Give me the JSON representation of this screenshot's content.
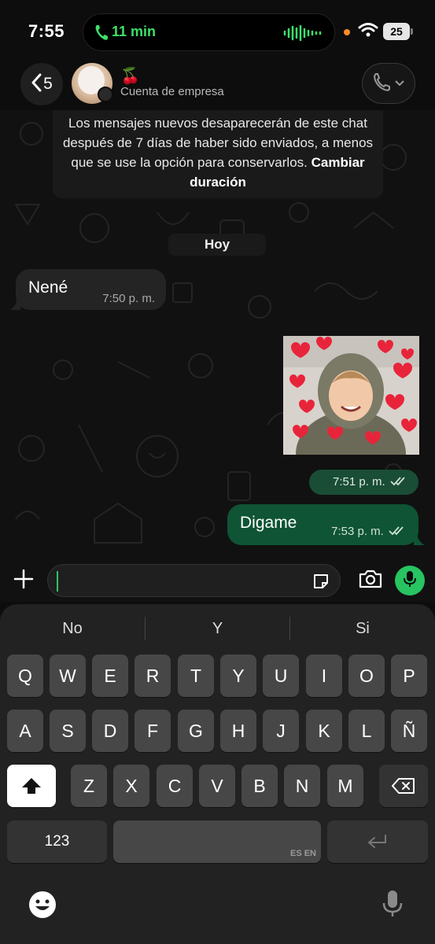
{
  "status_bar": {
    "time": "7:55",
    "call_duration": "11 min",
    "battery": "25"
  },
  "header": {
    "back_count": "5",
    "contact_emoji": "🍒",
    "subtitle": "Cuenta de empresa"
  },
  "notice": {
    "text": "Los mensajes nuevos desaparecerán de este chat después de 7 días de haber sido enviados, a menos que se use la opción para conservarlos.",
    "link": "Cambiar duración"
  },
  "day_label": "Hoy",
  "messages": [
    {
      "direction": "in",
      "text": "Nené",
      "time": "7:50 p. m."
    },
    {
      "direction": "out",
      "type": "image",
      "time": "7:51 p. m."
    },
    {
      "direction": "out",
      "text": "Digame",
      "time": "7:53 p. m."
    }
  ],
  "composer": {
    "value": "",
    "placeholder": ""
  },
  "keyboard": {
    "suggestions": [
      "No",
      "Y",
      "Si"
    ],
    "row1": [
      "Q",
      "W",
      "E",
      "R",
      "T",
      "Y",
      "U",
      "I",
      "O",
      "P"
    ],
    "row2": [
      "A",
      "S",
      "D",
      "F",
      "G",
      "H",
      "J",
      "K",
      "L",
      "Ñ"
    ],
    "row3": [
      "Z",
      "X",
      "C",
      "V",
      "B",
      "N",
      "M"
    ],
    "numbers_key": "123",
    "space_lang": "ES EN"
  },
  "colors": {
    "accent_green": "#27c461",
    "outgoing_bubble": "#0f5434",
    "incoming_bubble": "#242424",
    "call_green": "#3ee06a"
  },
  "icons": [
    "phone-icon",
    "wave-icon",
    "wifi-icon",
    "back-chevron-icon",
    "call-icon",
    "chevron-down-icon",
    "plus-icon",
    "sticker-icon",
    "camera-icon",
    "mic-icon",
    "shift-icon",
    "backspace-icon",
    "return-icon",
    "emoji-icon",
    "dictation-icon",
    "double-check-icon"
  ]
}
